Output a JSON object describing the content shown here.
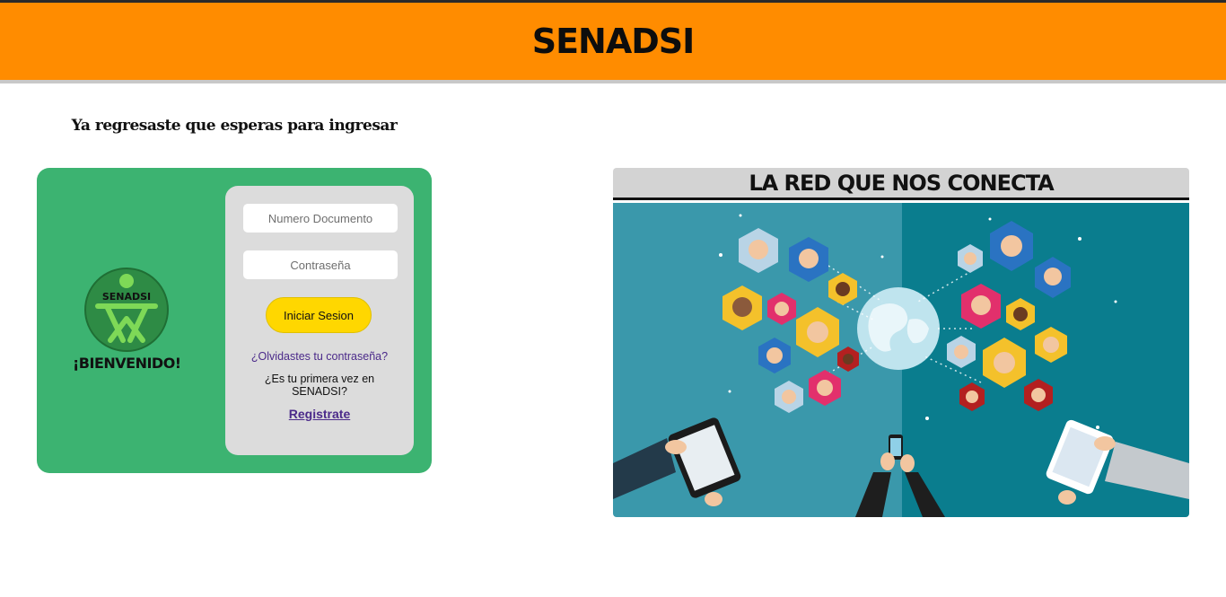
{
  "header": {
    "title": "SENADSI"
  },
  "tagline": "Ya regresaste que esperas para ingresar",
  "brand": {
    "logo_text": "SENADSI",
    "welcome": "¡BIENVENIDO!"
  },
  "login_form": {
    "document_placeholder": "Numero Documento",
    "password_placeholder": "Contraseña",
    "submit_label": "Iniciar Sesion",
    "forgot_label": "¿Olvidastes tu contraseña?",
    "first_time_text": "¿Es tu primera vez en SENADSI?",
    "register_label": "Registrate"
  },
  "banner": {
    "title": "LA RED QUE NOS CONECTA"
  },
  "colors": {
    "header": "#ff8c00",
    "card": "#3cb371",
    "panel": "#dcdcdc",
    "button": "#ffd700",
    "link": "#4b2a8a",
    "banner_bg": "#0e7f93"
  }
}
